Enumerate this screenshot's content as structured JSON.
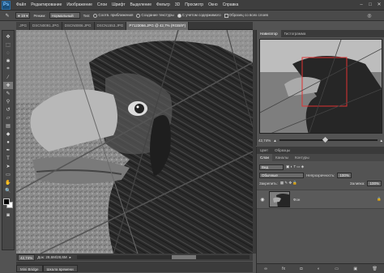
{
  "menubar": {
    "logo": "Ps",
    "items": [
      "Файл",
      "Редактирование",
      "Изображение",
      "Слои",
      "Шрифт",
      "Выделение",
      "Фильтр",
      "3D",
      "Просмотр",
      "Окно",
      "Справка"
    ],
    "window_controls": [
      "–",
      "□",
      "✕"
    ]
  },
  "options": {
    "mode_label": "Режим:",
    "mode_value": "Нормальный",
    "type_label": "Тип:",
    "radio1": "Соотв. приближения",
    "radio2": "Создание текстуры",
    "radio3": "С учетом содержимого",
    "checkbox": "Образец со всех слоев"
  },
  "tabs": [
    {
      "label": ".JPG"
    },
    {
      "label": "DSCN0091.JPG"
    },
    {
      "label": "DSCN0006.JPG"
    },
    {
      "label": "DSCN1553.JPG"
    },
    {
      "label": "P7123066.JPG @ 42,7% (RGB/8*)"
    }
  ],
  "status": {
    "zoom": "42,74%",
    "doc": "Док: 28,6M/28,6M"
  },
  "bottom_tabs": [
    "Mini Bridge",
    "Шкала времени"
  ],
  "navigator": {
    "tab1": "Навигатор",
    "tab2": "Гистограмма",
    "zoom": "42,74%"
  },
  "layers": {
    "tab1": "Цвет",
    "tab2": "Образцы",
    "sub_tabs": [
      "Слои",
      "Каналы",
      "Контуры"
    ],
    "kind": "Вид",
    "blend": "Обычные",
    "opacity_label": "Непрозрачность:",
    "opacity": "100%",
    "lock_label": "Закрепить:",
    "fill_label": "Заливка:",
    "fill": "100%",
    "layer_name": "Фон",
    "lock_icon": "🔒"
  },
  "colors": {
    "accent": "#2d6fa5",
    "panel": "#535353",
    "dark": "#3e3e3e"
  }
}
